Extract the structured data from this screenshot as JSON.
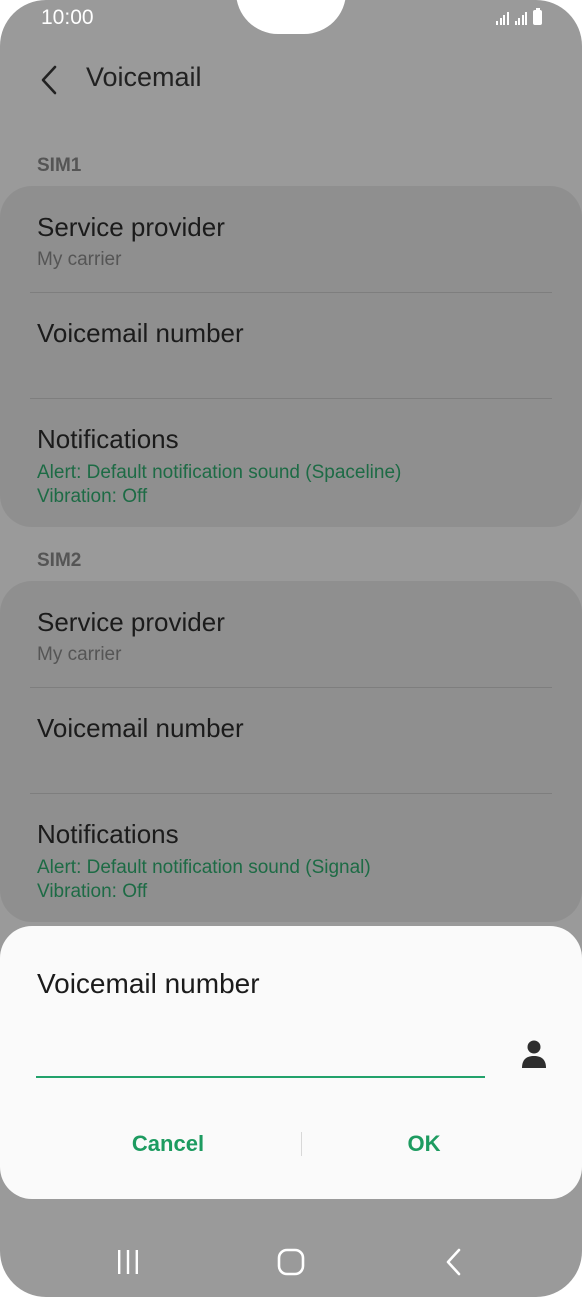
{
  "status_bar": {
    "time": "10:00"
  },
  "header": {
    "title": "Voicemail"
  },
  "sim1": {
    "label": "SIM1",
    "service_provider": {
      "title": "Service provider",
      "value": "My carrier"
    },
    "voicemail_number": {
      "title": "Voicemail number"
    },
    "notifications": {
      "title": "Notifications",
      "alert": "Alert: Default notification sound (Spaceline)",
      "vibration": "Vibration: Off"
    }
  },
  "sim2": {
    "label": "SIM2",
    "service_provider": {
      "title": "Service provider",
      "value": "My carrier"
    },
    "voicemail_number": {
      "title": "Voicemail number"
    },
    "notifications": {
      "title": "Notifications",
      "alert": "Alert: Default notification sound (Signal)",
      "vibration": "Vibration: Off"
    }
  },
  "dialog": {
    "title": "Voicemail number",
    "input_value": "",
    "cancel_label": "Cancel",
    "ok_label": "OK"
  },
  "colors": {
    "accent": "#1d9b60",
    "green_text": "#1d6b45",
    "scrim": "#9a9a9a",
    "dialog_bg": "#fafafa"
  },
  "icons": {
    "back": "chevron-left-icon",
    "contact": "person-icon",
    "recents": "recents-icon",
    "home": "home-icon",
    "nav_back": "nav-back-icon"
  }
}
